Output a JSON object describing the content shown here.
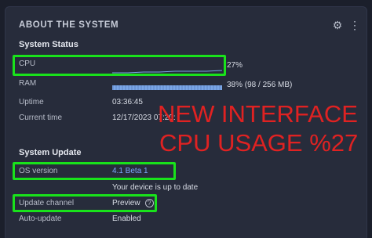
{
  "panel": {
    "title": "ABOUT THE SYSTEM"
  },
  "icons": {
    "settings": "gear-icon",
    "more": "more-vertical-icon"
  },
  "system_status": {
    "heading": "System Status",
    "cpu_label": "CPU",
    "cpu_value": "27%",
    "cpu_fraction": 0.27,
    "ram_label": "RAM",
    "ram_value": "38% (98 / 256 MB)",
    "ram_fraction": 0.38,
    "uptime_label": "Uptime",
    "uptime_value": "03:36:45",
    "time_label": "Current time",
    "time_value": "12/17/2023 07:20:"
  },
  "system_update": {
    "heading": "System Update",
    "os_label": "OS version",
    "os_value": "4.1 Beta 1",
    "status_text": "Your device is up to date",
    "channel_label": "Update channel",
    "channel_value": "Preview",
    "help_glyph": "?",
    "auto_label": "Auto-update",
    "auto_value": "Enabled"
  },
  "overlay": {
    "line1": "NEW INTERFACE",
    "line2": "CPU USAGE %27"
  },
  "colors": {
    "highlight": "#19e21b",
    "overlay_text": "#e02222",
    "link": "#7da7ff",
    "panel_bg": "#272c3b"
  }
}
